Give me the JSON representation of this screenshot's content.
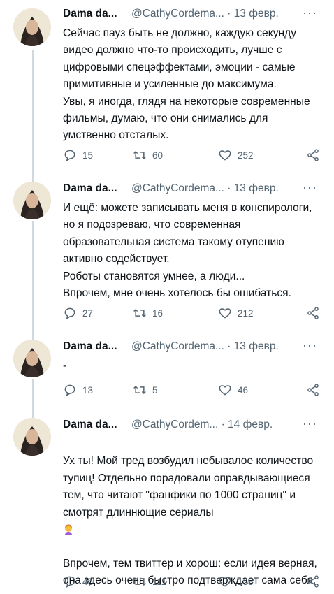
{
  "tweets": [
    {
      "name": "Dama da...",
      "handle": "@CathyCordema...",
      "date": "· 13 февр.",
      "more": "···",
      "text": "Сейчас пауз быть не должно, каждую секунду видео должно что-то происходить, лучше с цифровыми спецэффектами, эмоции - самые примитивные и усиленные до максимума.\nУвы, я иногда, глядя на некоторые современные фильмы, думаю, что они снимались для умственно отсталых.",
      "replies": "15",
      "retweets": "60",
      "likes": "252"
    },
    {
      "name": "Dama da...",
      "handle": "@CathyCordema...",
      "date": "· 13 февр.",
      "more": "···",
      "text": "И ещё: можете записывать меня в конспирологи, но я подозреваю, что современная образовательная система такому отупению активно содействует.\nРоботы становятся умнее, а люди...\nВпрочем, мне очень хотелось бы ошибаться.",
      "replies": "27",
      "retweets": "16",
      "likes": "212"
    },
    {
      "name": "Dama da...",
      "handle": "@CathyCordema...",
      "date": "· 13 февр.",
      "more": "···",
      "text": "-",
      "replies": "13",
      "retweets": "5",
      "likes": "46"
    },
    {
      "name": "Dama da...",
      "handle": "@CathyCordem...",
      "date": "· 14 февр.",
      "more": "···",
      "text_main": "Ух ты! Мой тред возбудил небывалое количество тупиц! Отдельно порадовали оправдывающиеся тем, что читают \"фанфики по 1000 страниц\" и смотрят длиннющие сериалы",
      "text_after": "Впрочем, тем твиттер и хорош: если идея верная, она здесь очень быстро подтверждает сама себя.",
      "emoji": "woman-facepalming-emoji",
      "replies": "45",
      "retweets": "111",
      "likes": "158"
    }
  ],
  "icons": {
    "reply": "reply-icon",
    "retweet": "retweet-icon",
    "like": "heart-icon",
    "share": "share-icon"
  },
  "colors": {
    "text": "#0f1419",
    "secondary": "#536471",
    "thread_line": "#cfd9de"
  }
}
